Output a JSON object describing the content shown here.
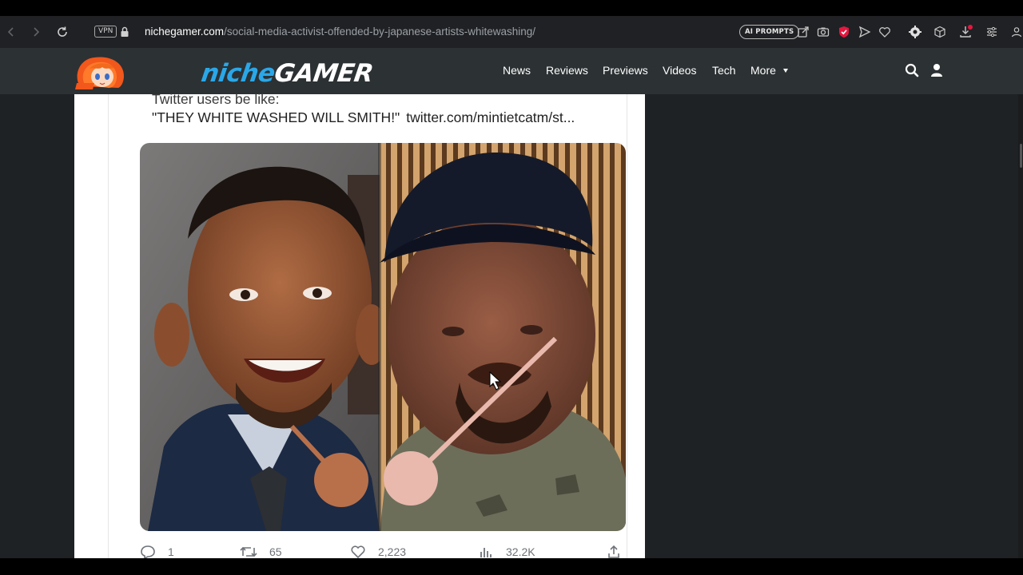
{
  "browser": {
    "vpn_label": "VPN",
    "url_domain": "nichegamer.com",
    "url_path": "/social-media-activist-offended-by-japanese-artists-whitewashing/",
    "ai_prompts_label": "AI PROMPTS",
    "icons": [
      "back-icon",
      "forward-icon",
      "reload-icon",
      "lock-icon",
      "share-icon",
      "camera-icon",
      "shield-icon",
      "send-icon",
      "heart-icon",
      "extension-icon",
      "box-icon",
      "download-icon",
      "menu-icon",
      "profile-icon"
    ]
  },
  "site": {
    "logo_niche": "niche",
    "logo_gamer": "GAMER",
    "nav": [
      "News",
      "Reviews",
      "Previews",
      "Videos",
      "Tech",
      "More"
    ],
    "accent": "#2aa7e8",
    "header_bg": "#2c3133"
  },
  "tweet": {
    "line1": "Twitter users be like:",
    "line2_quote": "\"THEY WHITE WASHED WILL SMITH!\"",
    "line2_link": "twitter.com/mintietcatm/st...",
    "skin_swatch_left": "#b8704a",
    "skin_swatch_right": "#e9b9ae",
    "actions": {
      "replies": "1",
      "retweets": "65",
      "likes": "2,223",
      "views": "32.2K"
    }
  }
}
